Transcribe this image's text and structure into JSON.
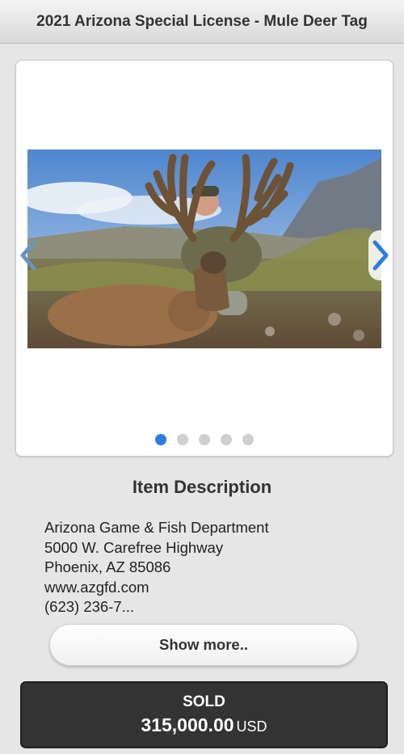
{
  "header": {
    "title": "2021 Arizona Special License - Mule Deer Tag"
  },
  "gallery": {
    "image_subject": "hunter-with-mule-deer-photo",
    "prev_icon": "chevron-left-icon",
    "next_icon": "chevron-right-icon",
    "slide_count": 5,
    "active_slide": 1
  },
  "description": {
    "title": "Item Description",
    "lines": [
      "Arizona Game & Fish Department",
      "5000 W. Carefree Highway",
      "Phoenix, AZ 85086",
      "www.azgfd.com",
      "(623) 236-7..."
    ],
    "show_more_label": "Show more.."
  },
  "sale": {
    "status": "SOLD",
    "price": "315,000.00",
    "currency": "USD"
  },
  "colors": {
    "accent": "#2a7de1",
    "sold_panel": "#333333",
    "background": "#e6e6e6"
  }
}
